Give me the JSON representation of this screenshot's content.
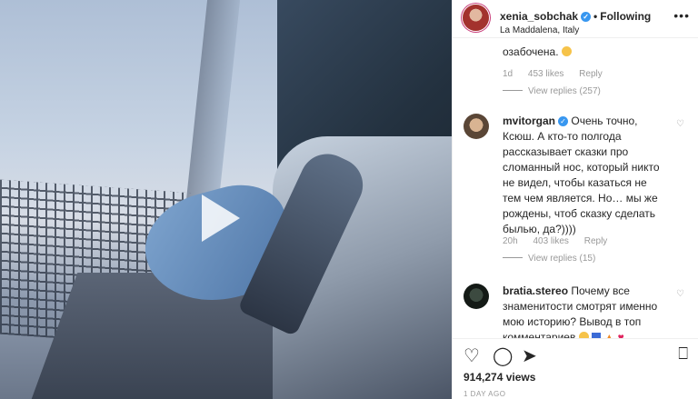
{
  "post": {
    "username": "xenia_sobchak",
    "follow_status": "Following",
    "location": "La Maddalena, Italy",
    "more_label": "•••"
  },
  "comments": {
    "partial_text": "озабочена.",
    "first_meta": {
      "time": "1d",
      "likes": "453 likes",
      "reply": "Reply",
      "view_replies": "View replies (257)"
    },
    "items": [
      {
        "username": "mvitorgan",
        "text": "Очень точно, Ксюш. А кто-то полгода рассказывает сказки про сломанный нос, который никто не видел, чтобы казаться не тем чем является. Но… мы же рождены, чтоб сказку сделать былью, да?))))",
        "time": "20h",
        "likes": "403 likes",
        "reply": "Reply",
        "view_replies": "View replies (15)"
      },
      {
        "username": "bratia.stereo",
        "text": "Почему все знаменитости смотрят именно мою историю? Вывод в топ комментариев"
      }
    ]
  },
  "actions": {
    "views": "914,274 views",
    "posted": "1 DAY AGO"
  },
  "icons": {
    "like": "heart-icon",
    "comment": "comment-icon",
    "share": "share-icon",
    "save": "bookmark-icon",
    "play": "play-icon",
    "verified": "verified-badge-icon"
  },
  "colors": {
    "verified": "#3897f0",
    "muted": "#999999",
    "text": "#262626"
  }
}
